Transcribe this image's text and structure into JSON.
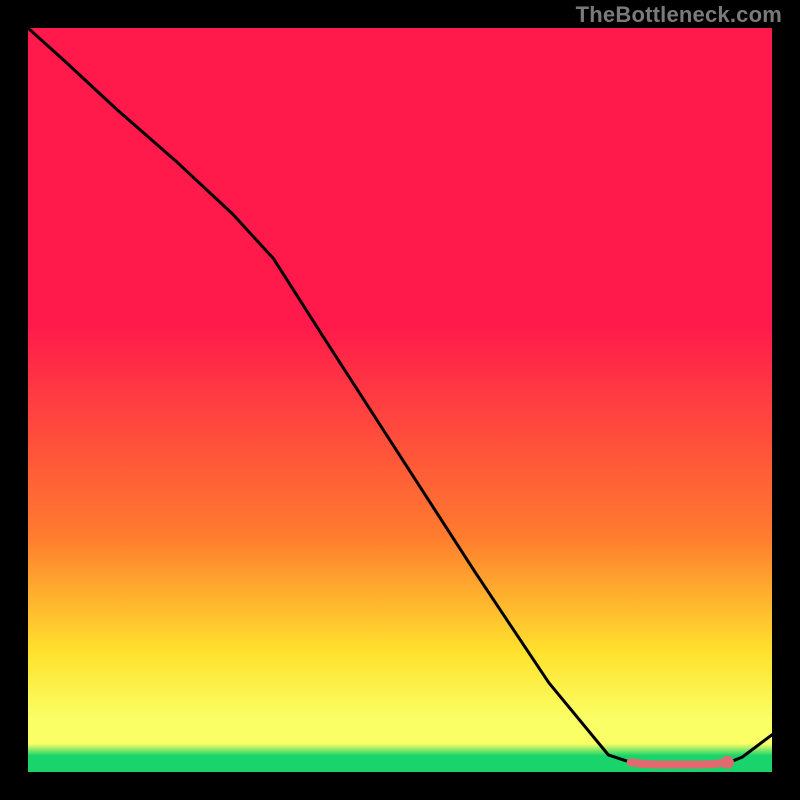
{
  "watermark": "TheBottleneck.com",
  "colors": {
    "bg": "#000000",
    "grad_top": "#ff1a4b",
    "grad_mid1": "#ff7a2f",
    "grad_mid2": "#ffe22d",
    "grad_low": "#faff66",
    "grad_green": "#18d46a",
    "line": "#000000",
    "marker": "#e06a6f"
  },
  "chart_data": {
    "type": "line",
    "title": "",
    "xlabel": "",
    "ylabel": "",
    "xlim": [
      0,
      100
    ],
    "ylim": [
      0,
      100
    ],
    "series": [
      {
        "name": "curve",
        "x": [
          0,
          5,
          12,
          20,
          27.5,
          33,
          40,
          50,
          60,
          70,
          78,
          81,
          84,
          90,
          94,
          96,
          100
        ],
        "y": [
          100,
          95.5,
          89,
          82,
          75,
          69,
          58,
          42.5,
          27,
          12,
          2.3,
          1.3,
          1.0,
          1.0,
          1.2,
          2.0,
          5.0
        ]
      }
    ],
    "markers": {
      "name": "optimal-segment",
      "points": [
        {
          "x": 81.0,
          "y": 1.3
        },
        {
          "x": 82.5,
          "y": 1.1
        },
        {
          "x": 84.5,
          "y": 1.0
        },
        {
          "x": 86.5,
          "y": 1.0
        },
        {
          "x": 87.5,
          "y": 1.0
        },
        {
          "x": 89.5,
          "y": 1.0
        },
        {
          "x": 90.5,
          "y": 1.0
        },
        {
          "x": 92.5,
          "y": 1.1
        },
        {
          "x": 94.0,
          "y": 1.3
        }
      ],
      "end_dot": {
        "x": 94.0,
        "y": 1.3
      }
    },
    "gradient_stops_pct": [
      0,
      40,
      68,
      84,
      93,
      96.2,
      97.8,
      100
    ],
    "green_band_top_pct": 96.5
  }
}
